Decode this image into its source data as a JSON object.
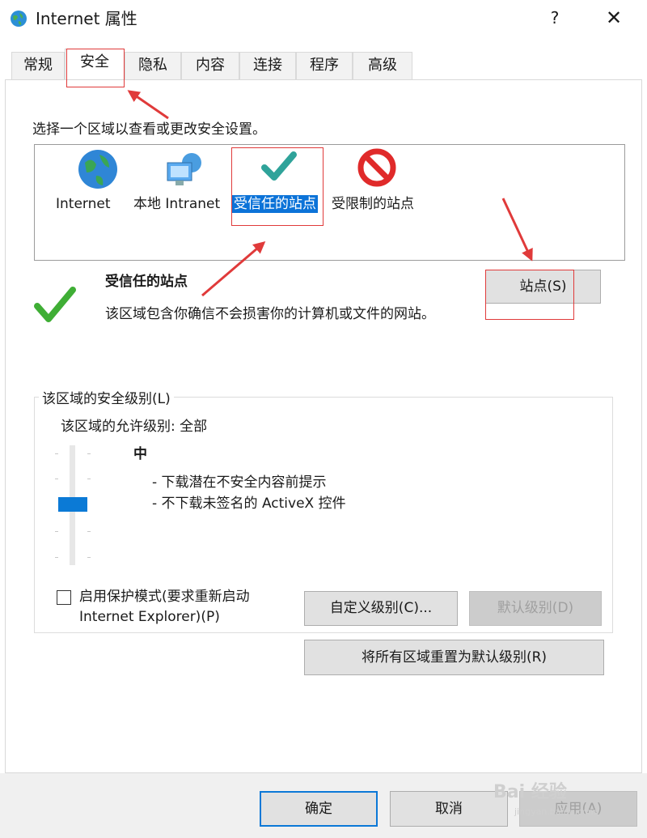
{
  "window": {
    "title": "Internet 属性",
    "help": "?",
    "close": "✕"
  },
  "tabs": [
    "常规",
    "安全",
    "隐私",
    "内容",
    "连接",
    "程序",
    "高级"
  ],
  "security": {
    "prompt": "选择一个区域以查看或更改安全设置。",
    "zones": [
      {
        "label": "Internet",
        "icon": "globe-icon"
      },
      {
        "label": "本地 Intranet",
        "icon": "intranet-icon"
      },
      {
        "label": "受信任的站点",
        "icon": "checkmark-icon"
      },
      {
        "label": "受限制的站点",
        "icon": "restricted-icon"
      }
    ],
    "selected_zone_title": "受信任的站点",
    "selected_zone_desc": "该区域包含你确信不会损害你的计算机或文件的网站。",
    "sites_button": "站点(S)"
  },
  "level_group": {
    "legend": "该区域的安全级别(L)",
    "allowed": "该区域的允许级别: 全部",
    "level_name": "中",
    "level_desc_1": "- 下载潜在不安全内容前提示",
    "level_desc_2": "- 不下载未签名的 ActiveX 控件",
    "protected_mode": "启用保护模式(要求重新启动 Internet Explorer)(P)",
    "custom_level_button": "自定义级别(C)...",
    "default_level_button": "默认级别(D)",
    "reset_all_button": "将所有区域重置为默认级别(R)"
  },
  "footer": {
    "ok": "确定",
    "cancel": "取消",
    "apply": "应用(A)"
  },
  "watermark": {
    "brand": "Bai 经验",
    "url": "jingyan.baidu.com"
  },
  "colors": {
    "accent": "#0c73d8",
    "annotation": "#e03a3a"
  }
}
